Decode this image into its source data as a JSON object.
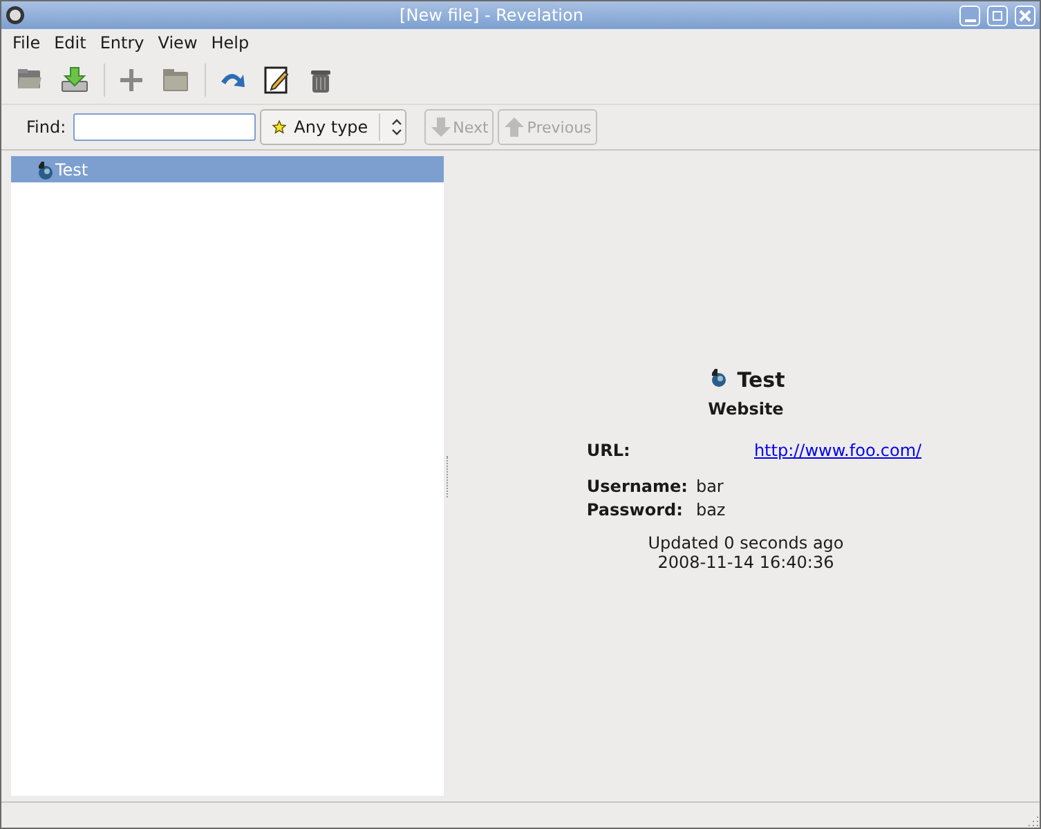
{
  "window": {
    "title": "[New file] - Revelation"
  },
  "menu": [
    {
      "label": "File"
    },
    {
      "label": "Edit"
    },
    {
      "label": "Entry"
    },
    {
      "label": "View"
    },
    {
      "label": "Help"
    }
  ],
  "toolbar": [
    {
      "kind": "open"
    },
    {
      "kind": "save"
    },
    {
      "kind": "separator"
    },
    {
      "kind": "add"
    },
    {
      "kind": "folder"
    },
    {
      "kind": "separator"
    },
    {
      "kind": "goto"
    },
    {
      "kind": "edit"
    },
    {
      "kind": "delete"
    }
  ],
  "find": {
    "label": "Find:",
    "type": "Any type",
    "next": {
      "label": "Next",
      "disabled": true
    },
    "previous": {
      "label": "Previous",
      "disabled": true
    }
  },
  "tree": [
    {
      "label": "Test",
      "selected": true
    }
  ],
  "entry": {
    "name": "Test",
    "type": "Website",
    "fields": [
      {
        "label": "URL:",
        "value": "http://www.foo.com/",
        "kind": "link"
      },
      {
        "label": "Username:",
        "value": "bar",
        "kind": "text"
      },
      {
        "label": "Password:",
        "value": "baz",
        "kind": "text"
      }
    ],
    "updated": "Updated 0 seconds ago",
    "date": "2008-11-14 16:40:36"
  }
}
